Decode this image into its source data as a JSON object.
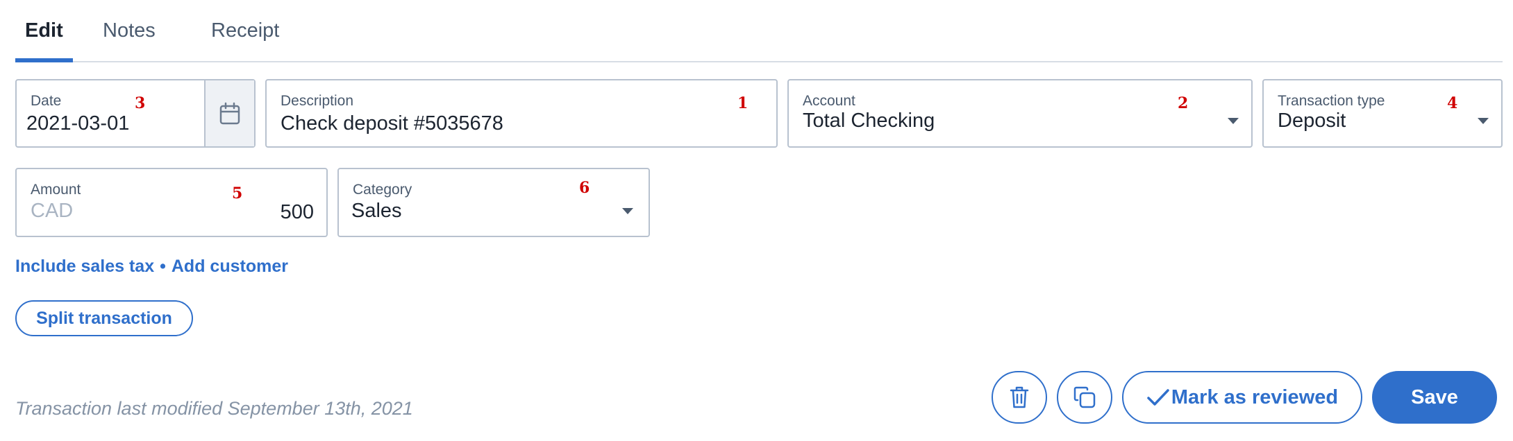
{
  "tabs": [
    {
      "label": "Edit",
      "active": true
    },
    {
      "label": "Notes",
      "active": false
    },
    {
      "label": "Receipt",
      "active": false
    }
  ],
  "fields": {
    "date": {
      "label": "Date",
      "value": "2021-03-01",
      "badge": "3",
      "icon": "calendar-icon"
    },
    "description": {
      "label": "Description",
      "value": "Check deposit #5035678",
      "badge": "1"
    },
    "account": {
      "label": "Account",
      "value": "Total Checking",
      "badge": "2",
      "icon": "caret-down-icon"
    },
    "transaction_type": {
      "label": "Transaction type",
      "value": "Deposit",
      "badge": "4",
      "icon": "caret-down-icon"
    },
    "amount": {
      "label": "Amount",
      "currency": "CAD",
      "value": "500",
      "badge": "5"
    },
    "category": {
      "label": "Category",
      "value": "Sales",
      "badge": "6",
      "icon": "caret-down-icon"
    }
  },
  "links": {
    "sales_tax": "Include sales tax",
    "separator": "•",
    "add_customer": "Add customer"
  },
  "buttons": {
    "split": "Split transaction",
    "delete_icon": "trash-icon",
    "copy_icon": "copy-icon",
    "review": "Mark as reviewed",
    "review_icon": "checkmark-icon",
    "save": "Save"
  },
  "footer": {
    "modified": "Transaction last modified September 13th, 2021"
  },
  "colors": {
    "accent": "#2f6fcb",
    "badge": "#d00000",
    "border": "#b8c2cf",
    "muted_text": "#8593a5"
  }
}
